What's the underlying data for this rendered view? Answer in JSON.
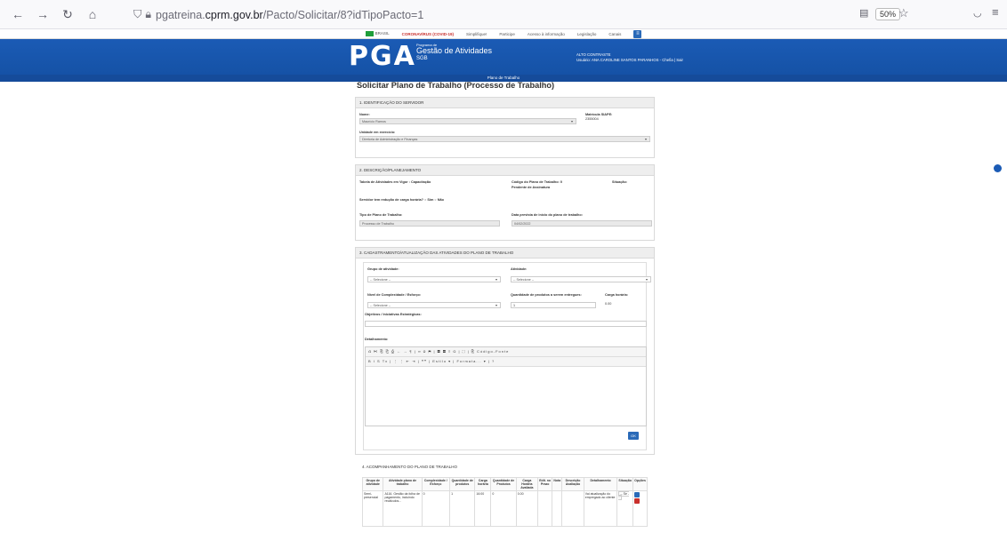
{
  "browser": {
    "url_prefix": "pgatreina.",
    "url_domain": "cprm.gov.br",
    "url_path": "/Pacto/Solicitar/8?idTipoPacto=1",
    "zoom": "50%"
  },
  "govbar": {
    "brasil": "BRASIL",
    "alert": "CORONAVÍRUS (COVID-19)",
    "links": [
      "Simplifique!",
      "Participe",
      "Acesso à informação",
      "Legislação",
      "Canais"
    ]
  },
  "banner": {
    "logo": "PGA",
    "program": "Programa de",
    "title": "Gestão de Atividades",
    "sub": "SGB",
    "contrast": "ALTO CONTRASTE",
    "user": "Usuário: ANA CAROLINE SANTOS PARANHOS - Chefia | Sair",
    "menu": "Plano de Trabalho"
  },
  "page": {
    "title": "Solicitar Plano de Trabalho (Processo de Trabalho)"
  },
  "sec1": {
    "header": "1. IDENTIFICAÇÃO DO SERVIDOR",
    "nome_label": "Nome:",
    "nome_value": "Maurício Ramos",
    "siape_label": "Matrícula SIAPE:",
    "siape_value": "2355004",
    "unidade_label": "Unidade em exercício:",
    "unidade_value": "Diretoria de Administração e Finanças"
  },
  "sec2": {
    "header": "2. DESCRIÇÃO/PLANEJAMENTO",
    "tabela": "Tabela de Atividades em Vigor : Capacitação",
    "codigo": "Código do Plano de Trabalho: 0",
    "pendente": "Pendente de Assinatura",
    "situacao": "Situação:",
    "reducao": "Servidor tem redução de carga horária?",
    "sim": "Sim",
    "nao": "Não",
    "tipo_label": "Tipo de Plano de Trabalho:",
    "tipo_value": "Processo de Trabalho",
    "data_label": "Data prevista de início do plano de trabalho:",
    "data_value": "04/02/2022"
  },
  "sec3": {
    "header": "3. CADASTRAMENTO/ATUALIZAÇÃO DAS ATIVIDADES DO PLANO DE TRABALHO",
    "grupo_label": "Grupo de atividade:",
    "grupo_value": "-- Selecione --",
    "atividade_label": "Atividade:",
    "atividade_value": "-- Selecione --",
    "nivel_label": "Nível de Complexidade / Esforço:",
    "nivel_value": "-- Selecione --",
    "qtd_label": "Quantidade de produtos a serem entregues:",
    "qtd_value": "1",
    "carga_label": "Carga horária:",
    "carga_value": "0.00",
    "obj_label": "Objetivos / Iniciativas Estratégicas:",
    "det_label": "Detalhamento:",
    "toolbar1": "⎌ ✂ ⎘ ⎗ ⎙ ← → ¶ | ∞ ⊘ ⚑ | ▦ ▤ ≡ Ω | ⛶ | ⎘ Código-Fonte",
    "toolbar2": "B I S Tx | ⋮ ⋮ ⇤ ⇥ | ❝❞ | Estilo ▾ | Formata... ▾ | ?",
    "ok": "OK"
  },
  "sec4": {
    "header": "4. ACOMPANHAMENTO DO PLANO DE TRABALHO",
    "columns": [
      "Grupo de atividade",
      "Atividade plano de trabalho",
      "Complexidade / Esforço",
      "Quantidade de produtos",
      "Carga horária",
      "Quantidade de Produtos",
      "Carga Horária Avaliada",
      "Edit. no Prazo",
      "Nota",
      "Descrição Avaliação",
      "Detalhamento",
      "Situação",
      "Opções"
    ],
    "row": [
      "Semi-presencial",
      "A116. Gestão da folha de pagamento, incluindo recálculos...",
      "0",
      "1",
      "16:00",
      "0",
      "0.00",
      "",
      "",
      "",
      "Vai atualização do empregado ao cliente",
      "-- Se --",
      ""
    ]
  }
}
